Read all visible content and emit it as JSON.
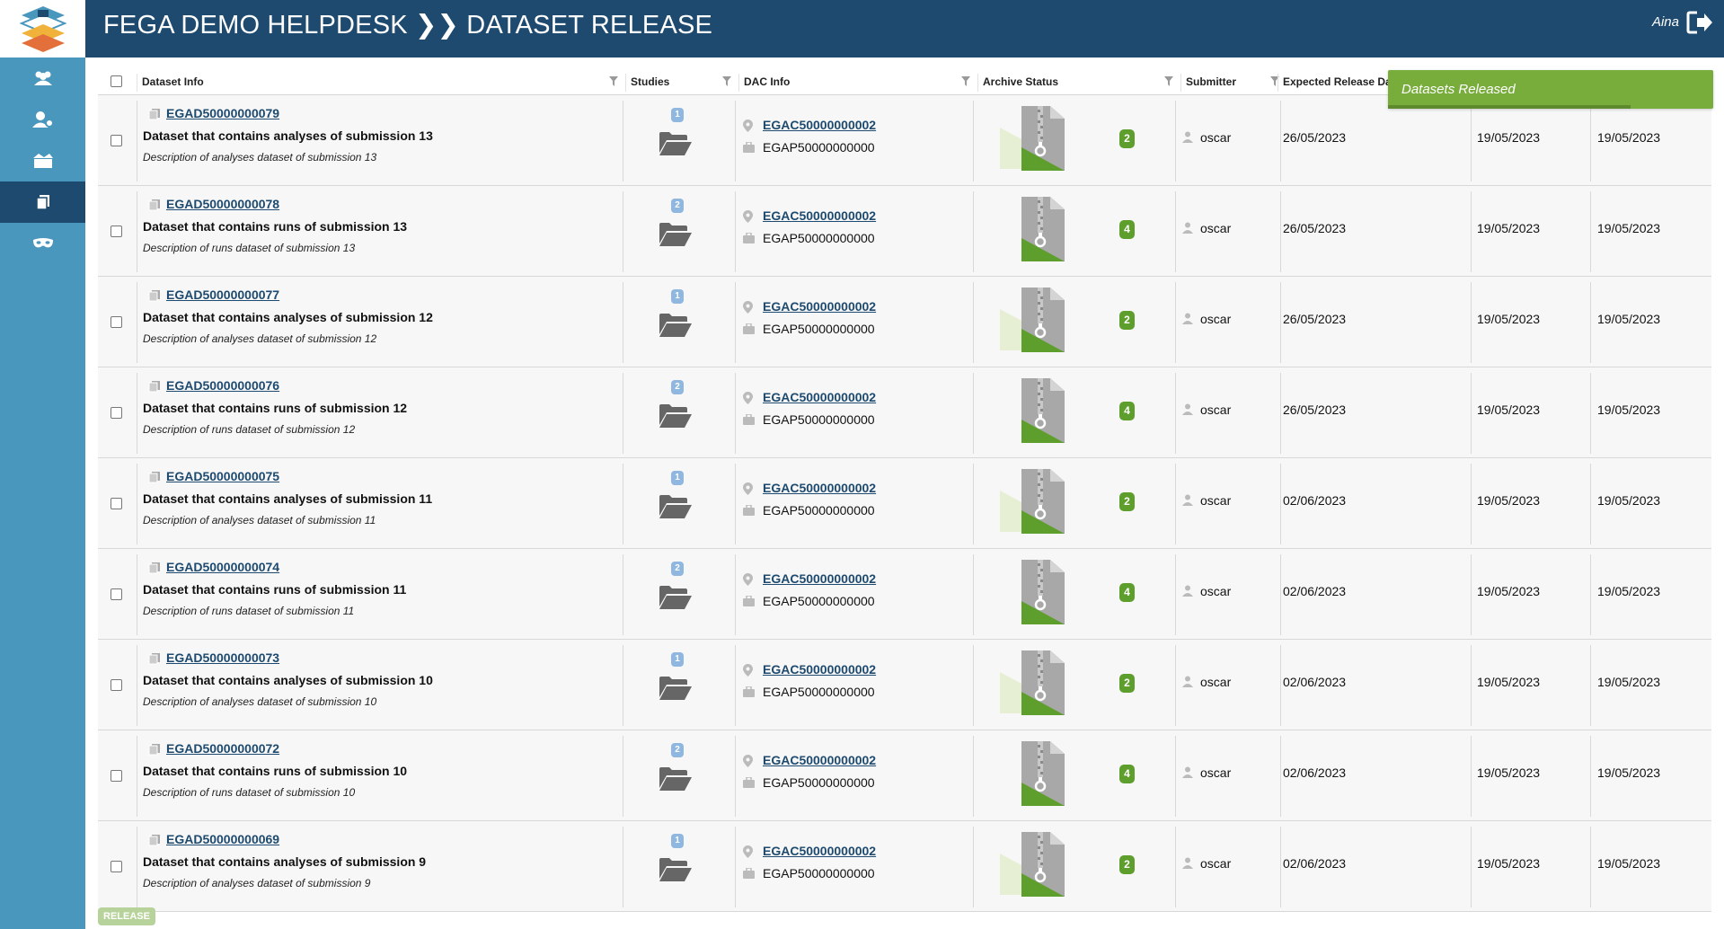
{
  "app": {
    "title": "FEGA DEMO HELPDESK ❯❯ DATASET RELEASE",
    "user": "Aina",
    "accent": "#1d4a6e",
    "sidebar_color": "#4a97be"
  },
  "sidebar": {
    "items": [
      {
        "icon": "users-icon"
      },
      {
        "icon": "user-gear-icon"
      },
      {
        "icon": "boxes-icon"
      },
      {
        "icon": "copy-icon",
        "active": true
      },
      {
        "icon": "mask-icon"
      }
    ]
  },
  "table": {
    "headers": [
      "Dataset Info",
      "Studies",
      "DAC Info",
      "Archive Status",
      "Submitter",
      "Expected Release Dat"
    ],
    "rows": [
      {
        "dataset_id": "EGAD50000000079",
        "title": "Dataset that contains analyses of submission 13",
        "description": "Description of analyses dataset of submission 13",
        "studies": "1",
        "dac": "EGAC50000000002",
        "policy": "EGAP50000000000",
        "archive_count": "2",
        "submitter": "oscar",
        "expected": "26/05/2023",
        "date1": "19/05/2023",
        "date2": "19/05/2023"
      },
      {
        "dataset_id": "EGAD50000000078",
        "title": "Dataset that contains runs of submission 13",
        "description": "Description of runs dataset of submission 13",
        "studies": "2",
        "dac": "EGAC50000000002",
        "policy": "EGAP50000000000",
        "archive_count": "4",
        "submitter": "oscar",
        "expected": "26/05/2023",
        "date1": "19/05/2023",
        "date2": "19/05/2023"
      },
      {
        "dataset_id": "EGAD50000000077",
        "title": "Dataset that contains analyses of submission 12",
        "description": "Description of analyses dataset of submission 12",
        "studies": "1",
        "dac": "EGAC50000000002",
        "policy": "EGAP50000000000",
        "archive_count": "2",
        "submitter": "oscar",
        "expected": "26/05/2023",
        "date1": "19/05/2023",
        "date2": "19/05/2023"
      },
      {
        "dataset_id": "EGAD50000000076",
        "title": "Dataset that contains runs of submission 12",
        "description": "Description of runs dataset of submission 12",
        "studies": "2",
        "dac": "EGAC50000000002",
        "policy": "EGAP50000000000",
        "archive_count": "4",
        "submitter": "oscar",
        "expected": "26/05/2023",
        "date1": "19/05/2023",
        "date2": "19/05/2023"
      },
      {
        "dataset_id": "EGAD50000000075",
        "title": "Dataset that contains analyses of submission 11",
        "description": "Description of analyses dataset of submission 11",
        "studies": "1",
        "dac": "EGAC50000000002",
        "policy": "EGAP50000000000",
        "archive_count": "2",
        "submitter": "oscar",
        "expected": "02/06/2023",
        "date1": "19/05/2023",
        "date2": "19/05/2023"
      },
      {
        "dataset_id": "EGAD50000000074",
        "title": "Dataset that contains runs of submission 11",
        "description": "Description of runs dataset of submission 11",
        "studies": "2",
        "dac": "EGAC50000000002",
        "policy": "EGAP50000000000",
        "archive_count": "4",
        "submitter": "oscar",
        "expected": "02/06/2023",
        "date1": "19/05/2023",
        "date2": "19/05/2023"
      },
      {
        "dataset_id": "EGAD50000000073",
        "title": "Dataset that contains analyses of submission 10",
        "description": "Description of analyses dataset of submission 10",
        "studies": "1",
        "dac": "EGAC50000000002",
        "policy": "EGAP50000000000",
        "archive_count": "2",
        "submitter": "oscar",
        "expected": "02/06/2023",
        "date1": "19/05/2023",
        "date2": "19/05/2023"
      },
      {
        "dataset_id": "EGAD50000000072",
        "title": "Dataset that contains runs of submission 10",
        "description": "Description of runs dataset of submission 10",
        "studies": "2",
        "dac": "EGAC50000000002",
        "policy": "EGAP50000000000",
        "archive_count": "4",
        "submitter": "oscar",
        "expected": "02/06/2023",
        "date1": "19/05/2023",
        "date2": "19/05/2023"
      },
      {
        "dataset_id": "EGAD50000000069",
        "title": "Dataset that contains analyses of submission 9",
        "description": "Description of analyses dataset of submission 9",
        "studies": "1",
        "dac": "EGAC50000000002",
        "policy": "EGAP50000000000",
        "archive_count": "2",
        "submitter": "oscar",
        "expected": "02/06/2023",
        "date1": "19/05/2023",
        "date2": "19/05/2023"
      }
    ]
  },
  "actions": {
    "release_label": "RELEASE"
  },
  "toast": {
    "message": "Datasets Released",
    "color": "#78ad3c"
  }
}
